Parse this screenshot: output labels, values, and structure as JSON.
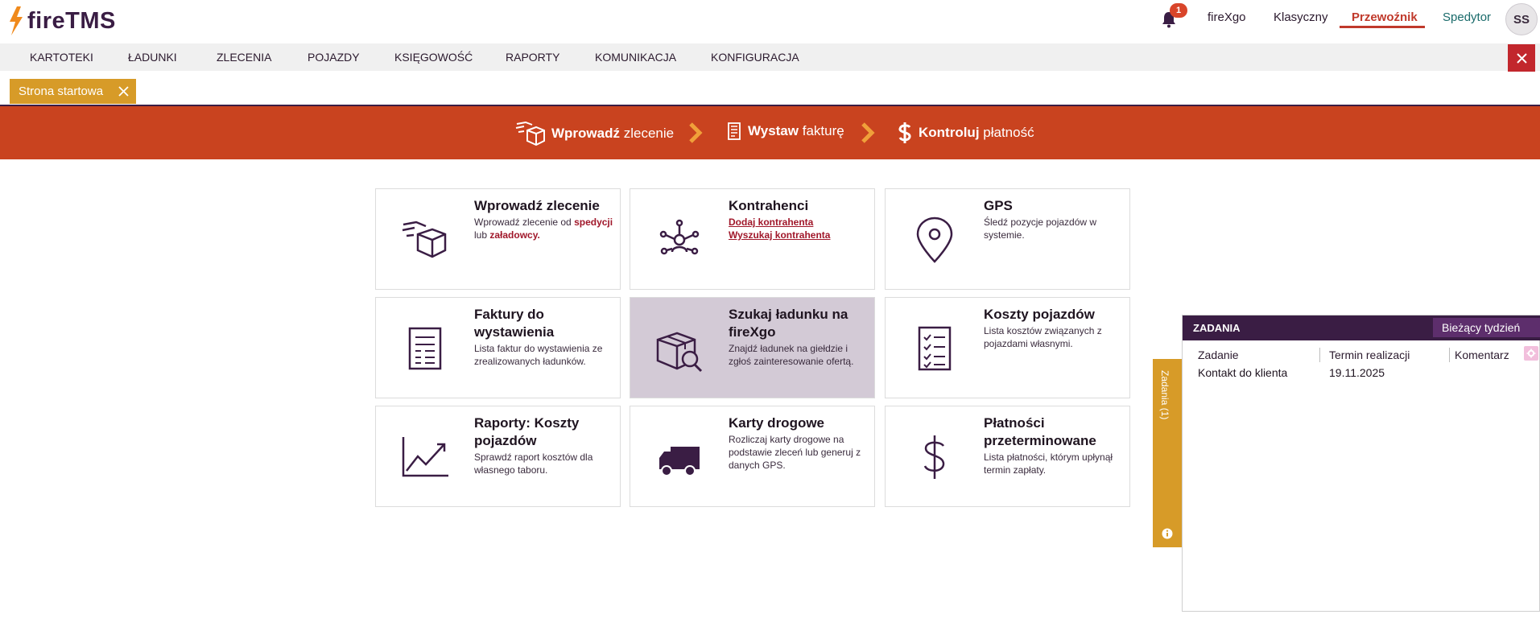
{
  "header": {
    "logo_text": "fireTMS",
    "notifications_count": "1",
    "modes": [
      "fireXgo",
      "Klasyczny",
      "Przewoźnik",
      "Spedytor"
    ],
    "active_mode": "Przewoźnik",
    "avatar_initials": "SS"
  },
  "menu": {
    "items": [
      "KARTOTEKI",
      "ŁADUNKI",
      "ZLECENIA",
      "POJAZDY",
      "KSIĘGOWOŚĆ",
      "RAPORTY",
      "KOMUNIKACJA",
      "KONFIGURACJA"
    ]
  },
  "tabs": [
    {
      "label": "Strona startowa"
    }
  ],
  "banner": {
    "steps": [
      {
        "bold": "Wprowadź",
        "rest": " zlecenie",
        "icon": "boxes-icon"
      },
      {
        "bold": "Wystaw",
        "rest": " fakturę",
        "icon": "invoice-icon"
      },
      {
        "bold": "Kontroluj",
        "rest": " płatność",
        "icon": "dollar-icon"
      }
    ]
  },
  "tiles": [
    {
      "title": "Wprowadź zlecenie",
      "desc_prefix": "Wprowadź zlecenie od ",
      "link1": "spedycji",
      "desc_mid": " lub ",
      "link2": "załadowcy.",
      "icon": "boxes-icon"
    },
    {
      "title": "Kontrahenci",
      "link1": "Dodaj kontrahenta",
      "link2": "Wyszukaj kontrahenta",
      "icon": "network-icon"
    },
    {
      "title": "GPS",
      "desc": "Śledź pozycje pojazdów w systemie.",
      "icon": "location-pin-icon"
    },
    {
      "title": "Faktury do wystawienia",
      "desc": "Lista faktur do wystawienia ze zrealizowanych ładunków.",
      "icon": "invoice-icon"
    },
    {
      "title": "Szukaj ładunku na fireXgo",
      "desc": "Znajdź ładunek na giełdzie i zgłoś zainteresowanie ofertą.",
      "icon": "box-search-icon"
    },
    {
      "title": "Koszty pojazdów",
      "desc": "Lista kosztów związanych z pojazdami własnymi.",
      "icon": "checklist-icon"
    },
    {
      "title": "Raporty: Koszty pojazdów",
      "desc": "Sprawdź raport kosztów dla własnego taboru.",
      "icon": "chart-up-icon"
    },
    {
      "title": "Karty drogowe",
      "desc": "Rozliczaj karty drogowe na podstawie zleceń lub generuj z danych GPS.",
      "icon": "truck-icon"
    },
    {
      "title": "Płatności przeterminowane",
      "desc": "Lista płatności, którym upłynął termin zapłaty.",
      "icon": "dollar-icon"
    }
  ],
  "side_tab": {
    "label": "Zadania (1)"
  },
  "tasks_panel": {
    "title": "ZADANIA",
    "filter": "Bieżący tydzień",
    "columns": [
      "Zadanie",
      "Termin realizacji",
      "Komentarz"
    ],
    "rows": [
      {
        "task": "Kontakt do klienta",
        "deadline": "19.11.2025",
        "comment": ""
      }
    ]
  },
  "colors": {
    "brand_purple": "#3a1d44",
    "banner_orange": "#c9431f",
    "tab_gold": "#d79b28",
    "link_red": "#a0172a"
  }
}
